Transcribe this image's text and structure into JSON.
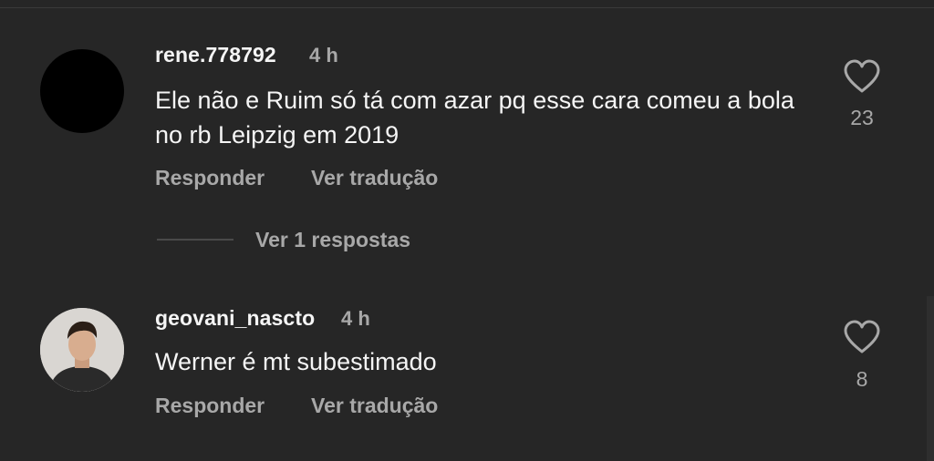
{
  "comments": [
    {
      "username": "rene.778792",
      "time": "4 h",
      "text": "Ele não e Ruim só tá com azar pq esse cara comeu a bola no rb Leipzig em 2019",
      "likes": "23",
      "reply_label": "Responder",
      "translate_label": "Ver tradução",
      "avatar": "black-avatar"
    },
    {
      "username": "geovani_nascto",
      "time": "4 h",
      "text": "Werner é mt subestimado",
      "likes": "8",
      "reply_label": "Responder",
      "translate_label": "Ver tradução",
      "avatar": "photo-avatar"
    }
  ],
  "replies": {
    "label": "Ver 1 respostas"
  },
  "icons": {
    "like": "heart-outline-icon"
  }
}
